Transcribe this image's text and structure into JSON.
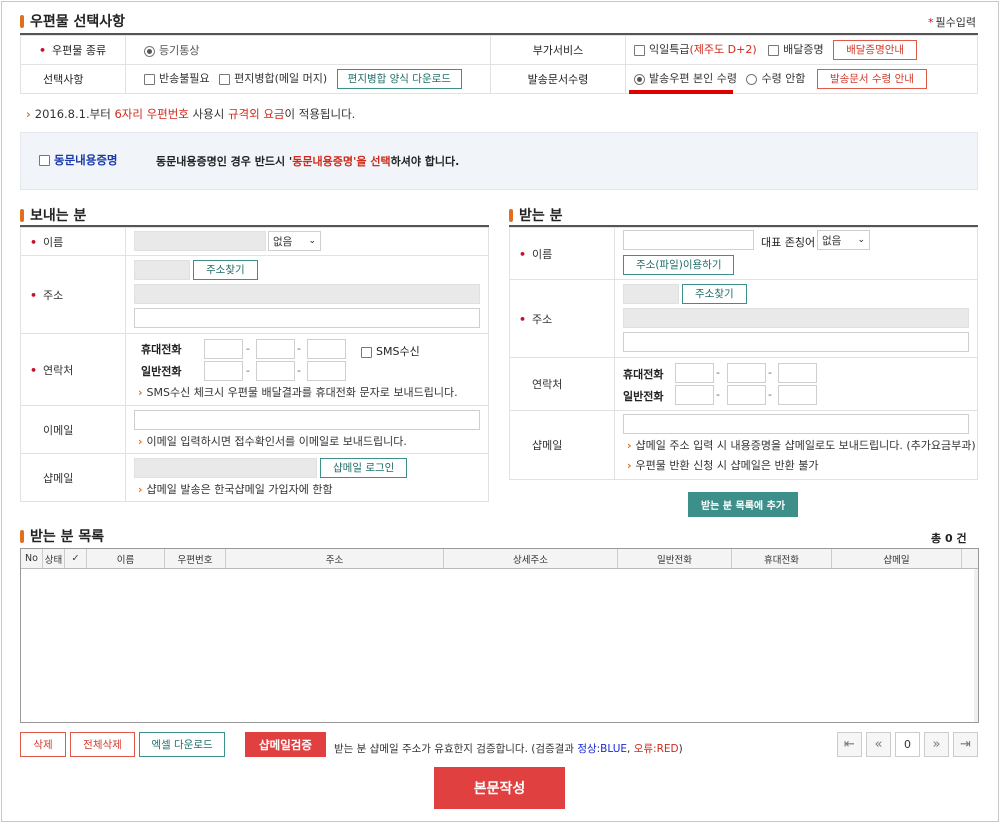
{
  "section_mail": {
    "title": "우편물 선택사항",
    "required_note": "필수입력",
    "mail_type_label": "우편물 종류",
    "mail_type_value": "등기통상",
    "options_label": "선택사항",
    "opt_no_return": "반송불필요",
    "opt_merge": "편지병합(메일 머지)",
    "merge_download_button": "편지병합 양식 다운로드",
    "extra_service_label": "부가서비스",
    "extra_next_day": "익일특급",
    "extra_next_day_note": "(제주도 D+2)",
    "extra_delivery_proof": "배달증명",
    "delivery_proof_guide_button": "배달증명안내",
    "doc_receive_label": "발송문서수령",
    "doc_receive_self": "발송우편 본인 수령",
    "doc_receive_none": "수령 안함",
    "doc_receive_guide_button": "발송문서 수령 안내"
  },
  "notice": {
    "prefix": "2016.8.1.부터 ",
    "highlight1": "6자리 우편번호",
    "mid": " 사용시 ",
    "highlight2": "규격외 요금",
    "suffix": "이 적용됩니다."
  },
  "same_content": {
    "checkbox_label": "동문내용증명",
    "desc_prefix": "동문내용증명인 경우 반드시 '",
    "desc_highlight": "동문내용증명'을 선택",
    "desc_suffix": "하셔야 합니다."
  },
  "sender": {
    "title": "보내는 분",
    "name_label": "이름",
    "title_select": "없음",
    "address_label": "주소",
    "find_address_button": "주소찾기",
    "contact_label": "연락처",
    "mobile_label": "휴대전화",
    "phone_label": "일반전화",
    "sms_label": "SMS수신",
    "sms_help": "SMS수신 체크시 우편물 배달결과를 휴대전화 문자로 보내드립니다.",
    "email_label": "이메일",
    "email_help": "이메일 입력하시면 접수확인서를 이메일로 보내드립니다.",
    "shopmail_label": "샵메일",
    "shopmail_login_button": "샵메일 로그인",
    "shopmail_help": "샵메일 발송은 한국샵메일 가입자에 한함"
  },
  "receiver": {
    "title": "받는 분",
    "name_label": "이름",
    "honorific_label": "대표 존칭어",
    "honorific_select": "없음",
    "file_address_button": "주소(파일)이용하기",
    "address_label": "주소",
    "find_address_button": "주소찾기",
    "contact_label": "연락처",
    "mobile_label": "휴대전화",
    "phone_label": "일반전화",
    "shopmail_label": "샵메일",
    "shopmail_help1": "샵메일 주소 입력 시 내용증명을 샵메일로도 보내드립니다. (추가요금부과)",
    "shopmail_help2": "우편물 반환 신청 시 샵메일은 반환 불가",
    "add_button": "받는 분 목록에 추가"
  },
  "receiver_list": {
    "title": "받는 분 목록",
    "total_prefix": "총 ",
    "total_count": "0",
    "total_suffix": " 건",
    "columns": [
      "No",
      "상태",
      "✓",
      "이름",
      "우편번호",
      "주소",
      "상세주소",
      "일반전화",
      "휴대전화",
      "샵메일"
    ]
  },
  "actions": {
    "delete": "삭제",
    "delete_all": "전체삭제",
    "excel_download": "엑셀 다운로드",
    "shopmail_verify": "샵메일검증",
    "verify_desc_prefix": "받는 분 샵메일 주소가 유효한지 검증합니다. (검증결과 ",
    "verify_ok": "정상:BLUE",
    "verify_sep": ", ",
    "verify_err": "오류:RED",
    "verify_desc_suffix": ")",
    "page_value": "0",
    "compose_button": "본문작성"
  },
  "colors": {
    "accent_orange": "#e07020",
    "required_red": "#c8102e",
    "teal": "#3d8f8a",
    "compose_red": "#e04040"
  }
}
